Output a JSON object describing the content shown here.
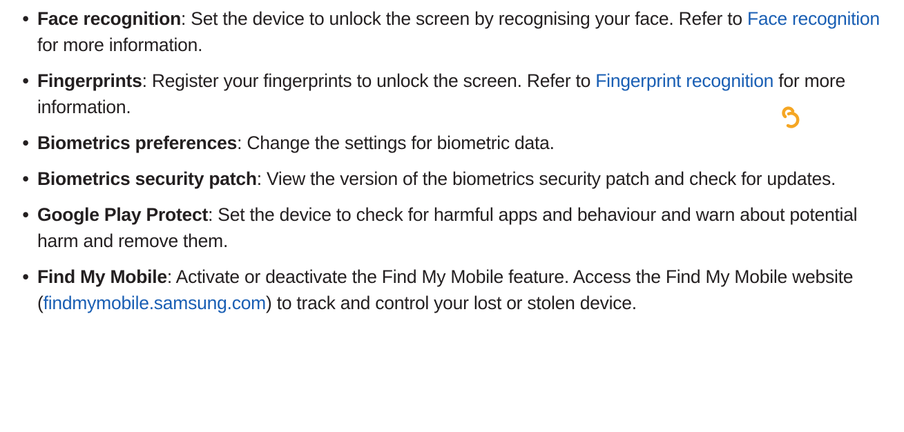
{
  "bullet_glyph": "•",
  "items": [
    {
      "term": "Face recognition",
      "text_before": ": Set the device to unlock the screen by recognising your face. Refer to ",
      "link": "Face recognition",
      "text_after": " for more information."
    },
    {
      "term": "Fingerprints",
      "text_before": ": Register your fingerprints to unlock the screen. Refer to ",
      "link": "Fingerprint recognition",
      "text_after": " for more information."
    },
    {
      "term": "Biometrics preferences",
      "text_before": ": Change the settings for biometric data."
    },
    {
      "term": "Biometrics security patch",
      "text_before": ": View the version of the biometrics security patch and check for updates."
    },
    {
      "term": "Google Play Protect",
      "text_before": ": Set the device to check for harmful apps and behaviour and warn about potential harm and remove them."
    },
    {
      "term": "Find My Mobile",
      "text_before": ": Activate or deactivate the Find My Mobile feature. Access the Find My Mobile website (",
      "link": "findmymobile.samsung.com",
      "text_after": ") to track and control your lost or stolen device."
    }
  ],
  "colors": {
    "text": "#231f20",
    "link": "#1a5fb4",
    "cursor": "#f5a623"
  },
  "cursor_icon": "loading-cursor-icon"
}
